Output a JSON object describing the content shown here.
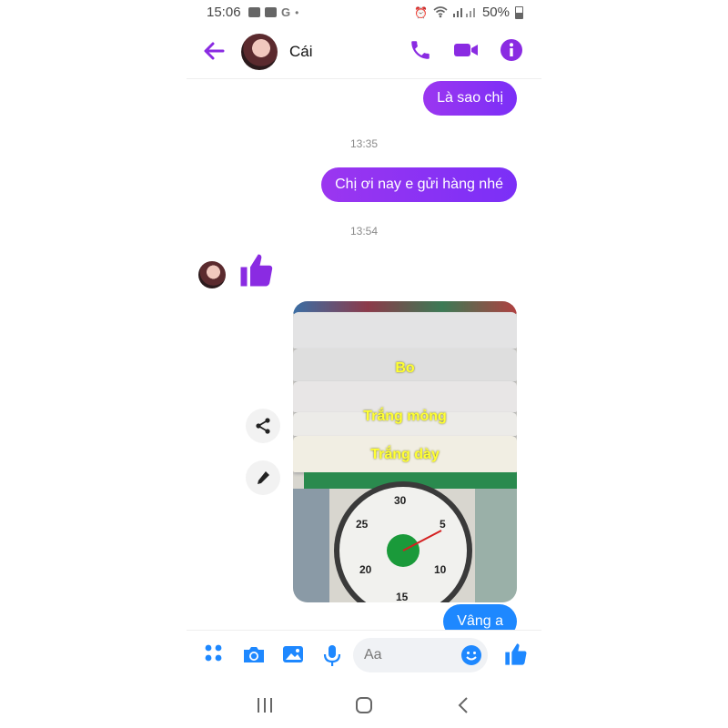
{
  "status_bar": {
    "time": "15:06",
    "battery": "50%"
  },
  "header": {
    "contact_name": "Cái"
  },
  "messages": {
    "out_1": "Là sao chị",
    "time_1": "13:35",
    "out_2": "Chị ơi nay e gửi hàng nhé",
    "time_2": "13:54",
    "photo_labels": [
      "Bo",
      "Trắng mỏng",
      "Trắng dày"
    ],
    "scale_numbers": [
      "30",
      "5",
      "25",
      "10",
      "20",
      "15"
    ],
    "out_3": "Vâng a"
  },
  "composer": {
    "placeholder": "Aa"
  },
  "colors": {
    "accent": "#8a2be2",
    "blue": "#1e88ff"
  }
}
